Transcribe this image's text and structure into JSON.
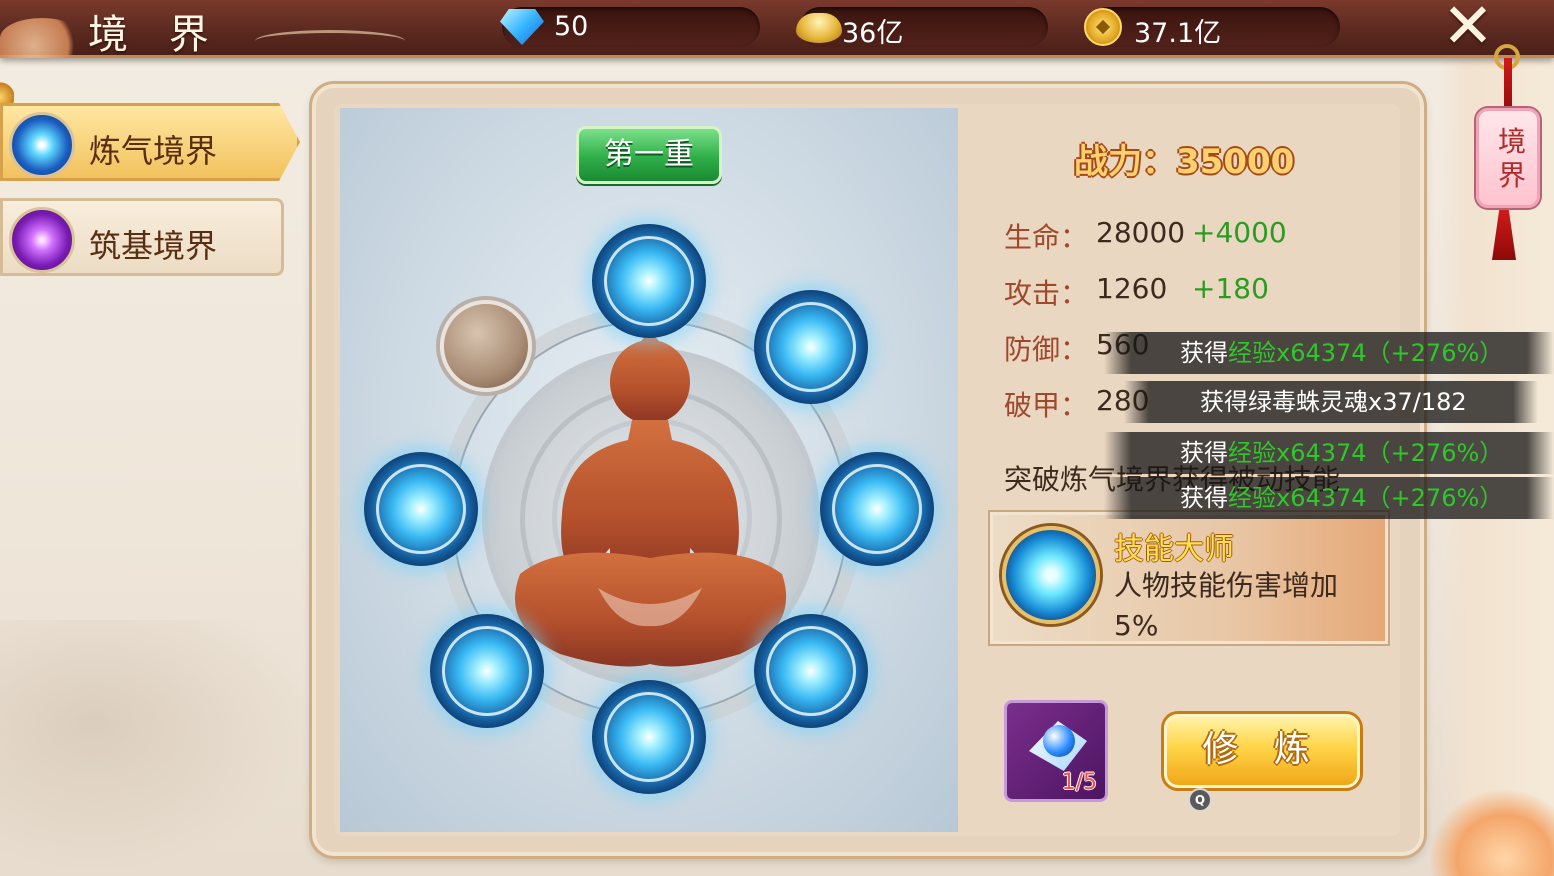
{
  "header": {
    "title": "境 界",
    "resources": [
      {
        "icon": "diamond-icon",
        "value": "50"
      },
      {
        "icon": "gold-ingot-icon",
        "value": "36亿"
      },
      {
        "icon": "copper-coin-icon",
        "value": "37.1亿"
      }
    ],
    "close_icon": "close-icon"
  },
  "sidebar": {
    "tabs": [
      {
        "label": "炼气境界",
        "icon": "qi-orb-icon",
        "active": true
      },
      {
        "label": "筑基境界",
        "icon": "foundation-orb-icon",
        "active": false
      }
    ]
  },
  "meridian": {
    "stage_label": "第一重",
    "lit_nodes": 7,
    "total_nodes": 8
  },
  "stats": {
    "power_label": "战力：",
    "power_value": "35000",
    "rows": [
      {
        "label": "生命：",
        "value": "28000",
        "bonus": "+4000"
      },
      {
        "label": "攻击：",
        "value": "1260",
        "bonus": "+180"
      },
      {
        "label": "防御：",
        "value": "560",
        "bonus": ""
      },
      {
        "label": "破甲：",
        "value": "280",
        "bonus": ""
      }
    ],
    "breakthrough_text": "突破炼气境界获得被动技能"
  },
  "skill": {
    "name": "技能大师",
    "description": "人物技能伤害增加5%",
    "icon": "skill-orb-icon"
  },
  "item": {
    "icon": "cultivation-gem-icon",
    "count": "1/5"
  },
  "actions": {
    "cultivate_label": "修 炼",
    "badge_text": "Q"
  },
  "notifications": [
    {
      "prefix": "获得",
      "highlight": "经验x64374（+276%）",
      "suffix": ""
    },
    {
      "prefix": "获得绿毒蛛灵魂x37/182",
      "highlight": "",
      "suffix": ""
    },
    {
      "prefix": "获得",
      "highlight": "经验x64374（+276%）",
      "suffix": ""
    },
    {
      "prefix": "获得",
      "highlight": "经验x64374（+276%）",
      "suffix": ""
    }
  ],
  "right_tab": {
    "label": "境界"
  },
  "colors": {
    "header_bg": "#5c2a20",
    "accent_gold": "#ffd071",
    "bonus_green": "#2d9b22",
    "stat_label": "#a0482c"
  }
}
